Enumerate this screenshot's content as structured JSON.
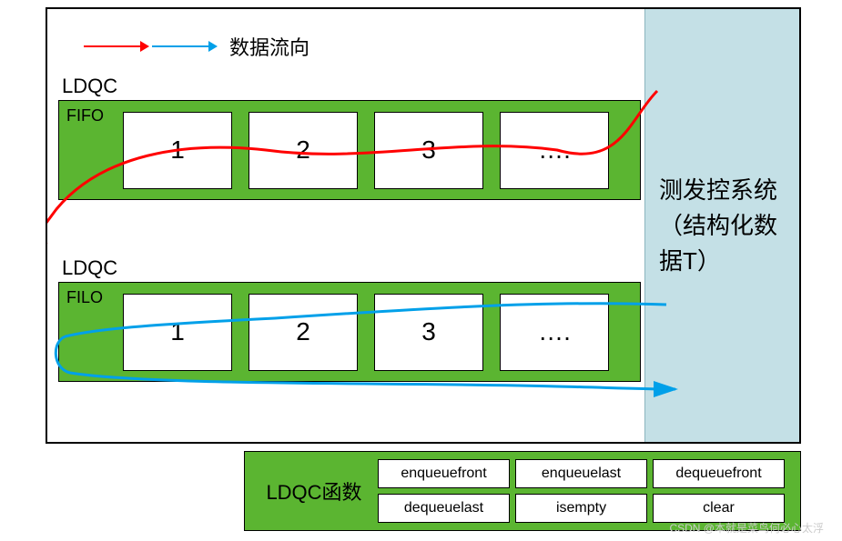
{
  "legend": {
    "label": "数据流向"
  },
  "queues": {
    "ldqc_label": "LDQC",
    "fifo": {
      "type": "FIFO",
      "cells": [
        "1",
        "2",
        "3",
        "…."
      ]
    },
    "filo": {
      "type": "FILO",
      "cells": [
        "1",
        "2",
        "3",
        "…."
      ]
    }
  },
  "right_panel": {
    "text": "测发控系统（结构化数据T）"
  },
  "functions": {
    "label": "LDQC函数",
    "items": [
      "enqueuefront",
      "enqueuelast",
      "dequeuefront",
      "dequeuelast",
      "isempty",
      "clear"
    ]
  },
  "watermark": "CSDN @本就是菜鸟何必心太浮",
  "colors": {
    "green": "#5bb531",
    "panel_blue": "#c4e0e6",
    "flow_red": "#ff0000",
    "flow_blue": "#00a0e9"
  }
}
